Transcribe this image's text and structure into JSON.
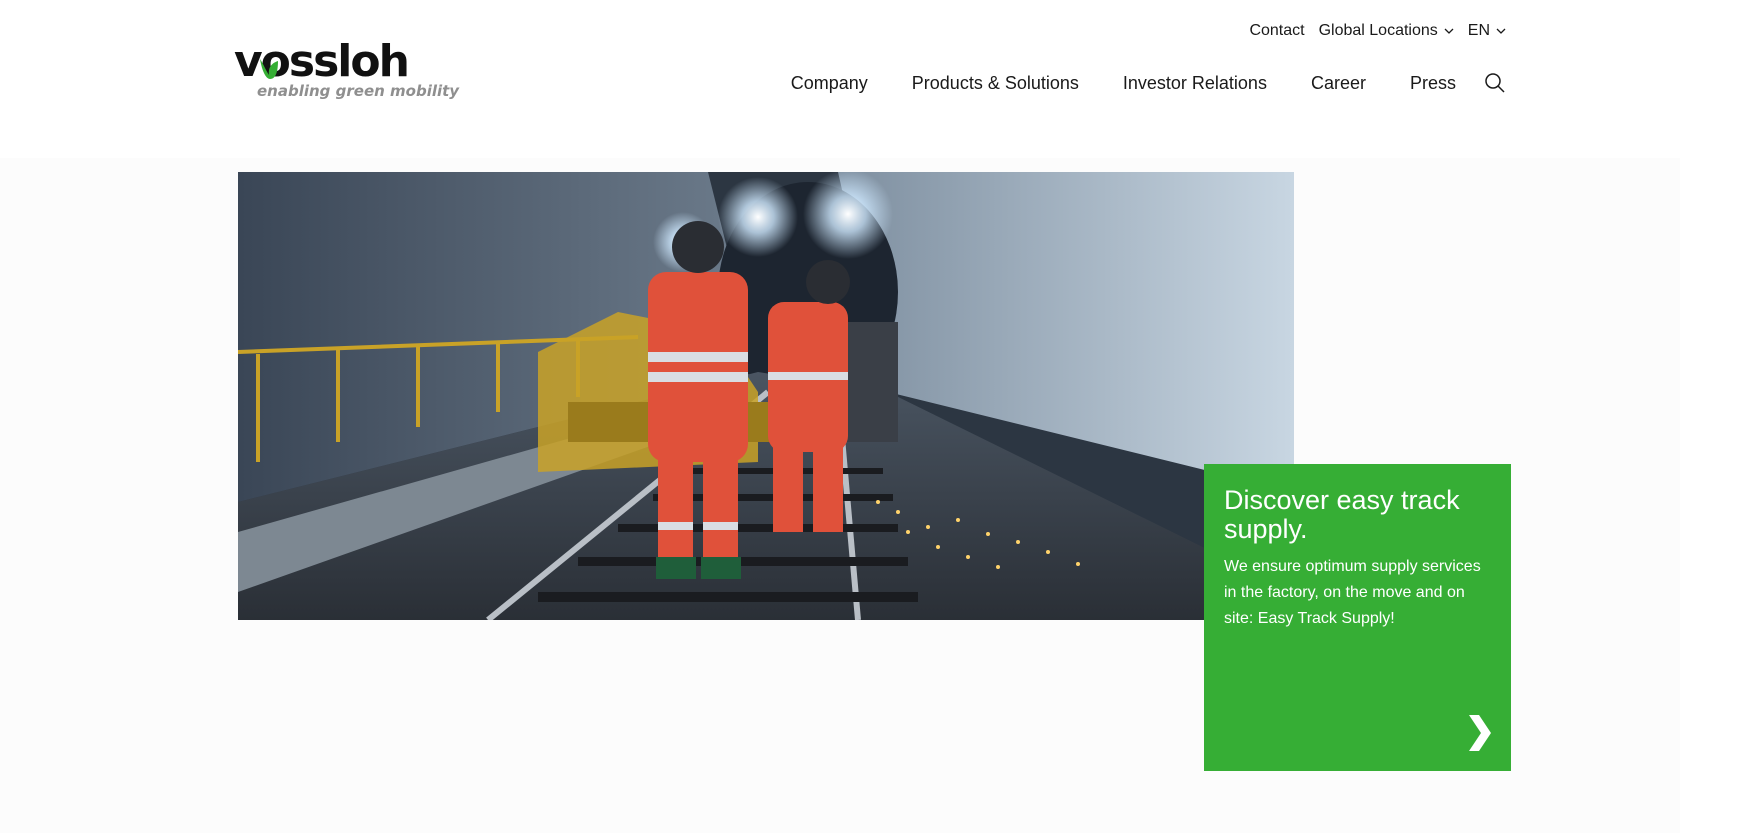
{
  "brand": {
    "name": "vossloh",
    "tagline": "enabling green mobility",
    "green": "#36ae35"
  },
  "topbar": {
    "contact": "Contact",
    "locations": "Global Locations",
    "language": "EN"
  },
  "nav": {
    "items": [
      {
        "label": "Company"
      },
      {
        "label": "Products & Solutions"
      },
      {
        "label": "Investor Relations"
      },
      {
        "label": "Career"
      },
      {
        "label": "Press"
      }
    ],
    "search_icon": "search-icon"
  },
  "hero": {
    "image": "workers-grinding-rail-in-tunnel"
  },
  "promo": {
    "title": "Discover easy track supply.",
    "text": "We ensure optimum supply services in the factory, on the move and on site: Easy Track Supply!",
    "arrow_icon": "chevron-right-icon"
  }
}
